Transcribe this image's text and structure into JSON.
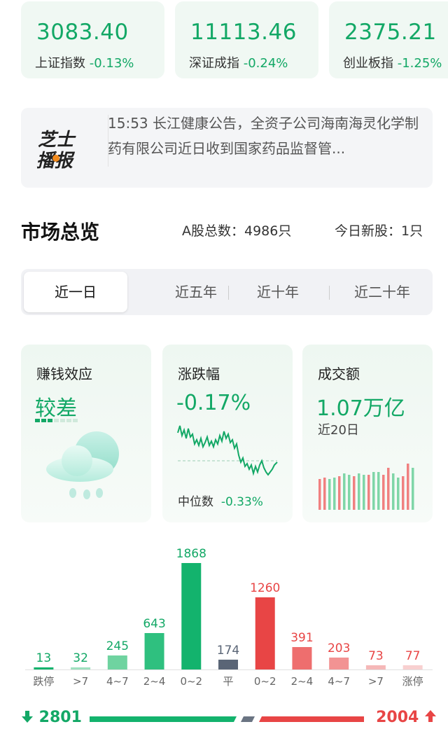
{
  "indices": [
    {
      "value": "3083.40",
      "name": "上证指数",
      "change": "-0.13%"
    },
    {
      "value": "11113.46",
      "name": "深证成指",
      "change": "-0.24%"
    },
    {
      "value": "2375.21",
      "name": "创业板指",
      "change": "-1.25%"
    }
  ],
  "news": {
    "logo_text": "芝士播报",
    "text": "15:53 长江健康公告，全资子公司海南海灵化学制药有限公司近日收到国家药品监督管..."
  },
  "overview": {
    "title": "市场总览",
    "total_label": "A股总数：4986只",
    "new_label": "今日新股：1只"
  },
  "tabs": [
    "近一日",
    "近五年",
    "近十年",
    "近二十年"
  ],
  "cards": {
    "money_effect": {
      "title": "赚钱效应",
      "value": "较差"
    },
    "change": {
      "title": "涨跌幅",
      "value": "-0.17%",
      "median_label": "中位数",
      "median_value": "-0.33%"
    },
    "turnover": {
      "title": "成交额",
      "value": "1.07万亿",
      "sub": "近20日"
    }
  },
  "chart_data": {
    "type": "bar",
    "categories": [
      "跌停",
      ">7",
      "4~7",
      "2~4",
      "0~2",
      "平",
      "0~2",
      "2~4",
      "4~7",
      ">7",
      "涨停"
    ],
    "values": [
      13,
      32,
      245,
      643,
      1868,
      174,
      1260,
      391,
      203,
      73,
      77
    ],
    "colors": [
      "#13b36d",
      "#9fe0bf",
      "#6fd3a0",
      "#2fc07f",
      "#13b36d",
      "#5a6576",
      "#e84545",
      "#ee6e6e",
      "#f29393",
      "#f5b8b8",
      "#f8d0d0"
    ],
    "label_colors": [
      "#13a866",
      "#13a866",
      "#13a866",
      "#13a866",
      "#13a866",
      "#5a6576",
      "#e84545",
      "#e84545",
      "#e84545",
      "#e84545",
      "#e84545"
    ]
  },
  "breadth": {
    "down": "2801",
    "up": "2004"
  },
  "colors": {
    "green": "#13a866",
    "red": "#e84545",
    "card_bg": "#f0f8f3"
  }
}
